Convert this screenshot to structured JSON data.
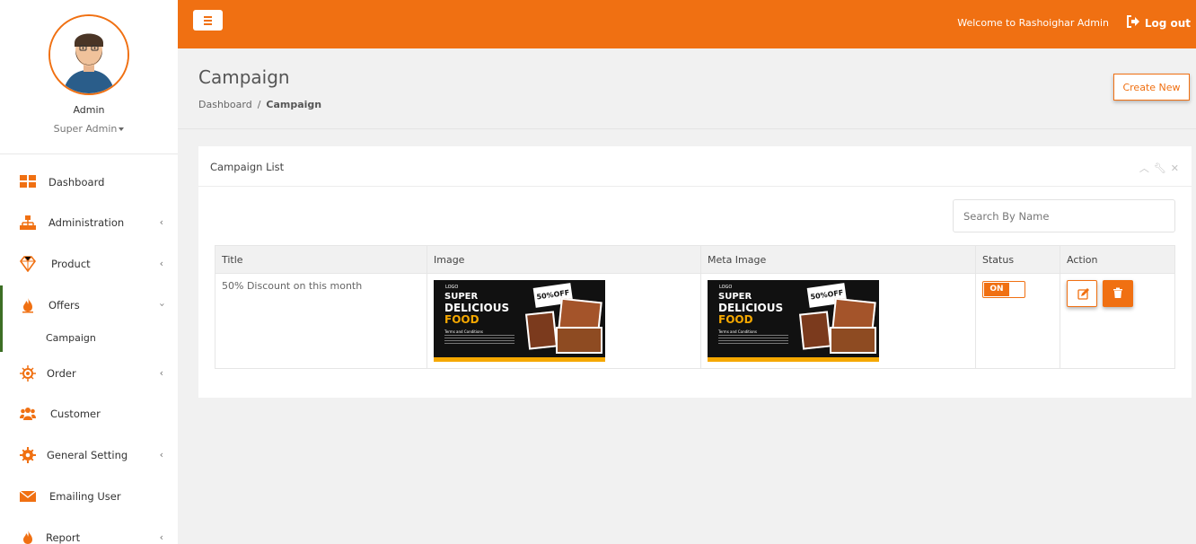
{
  "profile": {
    "name": "Admin",
    "role": "Super Admin"
  },
  "sidebar": {
    "items": [
      {
        "label": "Dashboard",
        "icon": "dashboard-grid-icon",
        "has_submenu": false
      },
      {
        "label": "Administration",
        "icon": "sitemap-icon",
        "has_submenu": true
      },
      {
        "label": "Product",
        "icon": "diamond-icon",
        "has_submenu": true
      },
      {
        "label": "Offers",
        "icon": "fire-icon",
        "has_submenu": true,
        "expanded": true
      },
      {
        "label": "Order",
        "icon": "gear-sun-icon",
        "has_submenu": true
      },
      {
        "label": "Customer",
        "icon": "users-icon",
        "has_submenu": false
      },
      {
        "label": "General Setting",
        "icon": "gear-icon",
        "has_submenu": true
      },
      {
        "label": "Emailing User",
        "icon": "envelope-icon",
        "has_submenu": false
      },
      {
        "label": "Report",
        "icon": "fire-icon",
        "has_submenu": true
      }
    ],
    "submenu": {
      "label": "Campaign"
    }
  },
  "topbar": {
    "welcome": "Welcome to Rashoighar Admin",
    "logout": "Log out"
  },
  "page": {
    "title": "Campaign",
    "breadcrumb": {
      "home": "Dashboard",
      "sep": "/",
      "current": "Campaign"
    },
    "create_button": "Create New"
  },
  "panel": {
    "title": "Campaign List",
    "search_placeholder": "Search By Name",
    "columns": [
      "Title",
      "Image",
      "Meta Image",
      "Status",
      "Action"
    ],
    "rows": [
      {
        "title": "50% Discount on this month",
        "status": "ON"
      }
    ]
  },
  "banner": {
    "logo": "LOGO",
    "line1": "SUPER",
    "line2": "DELICIOUS",
    "line3": "FOOD",
    "badge": "50%OFF",
    "terms": "Terms and Conditions"
  },
  "colors": {
    "accent": "#f07012",
    "active_bar": "#3c6e24",
    "background": "#f1f1f1"
  }
}
